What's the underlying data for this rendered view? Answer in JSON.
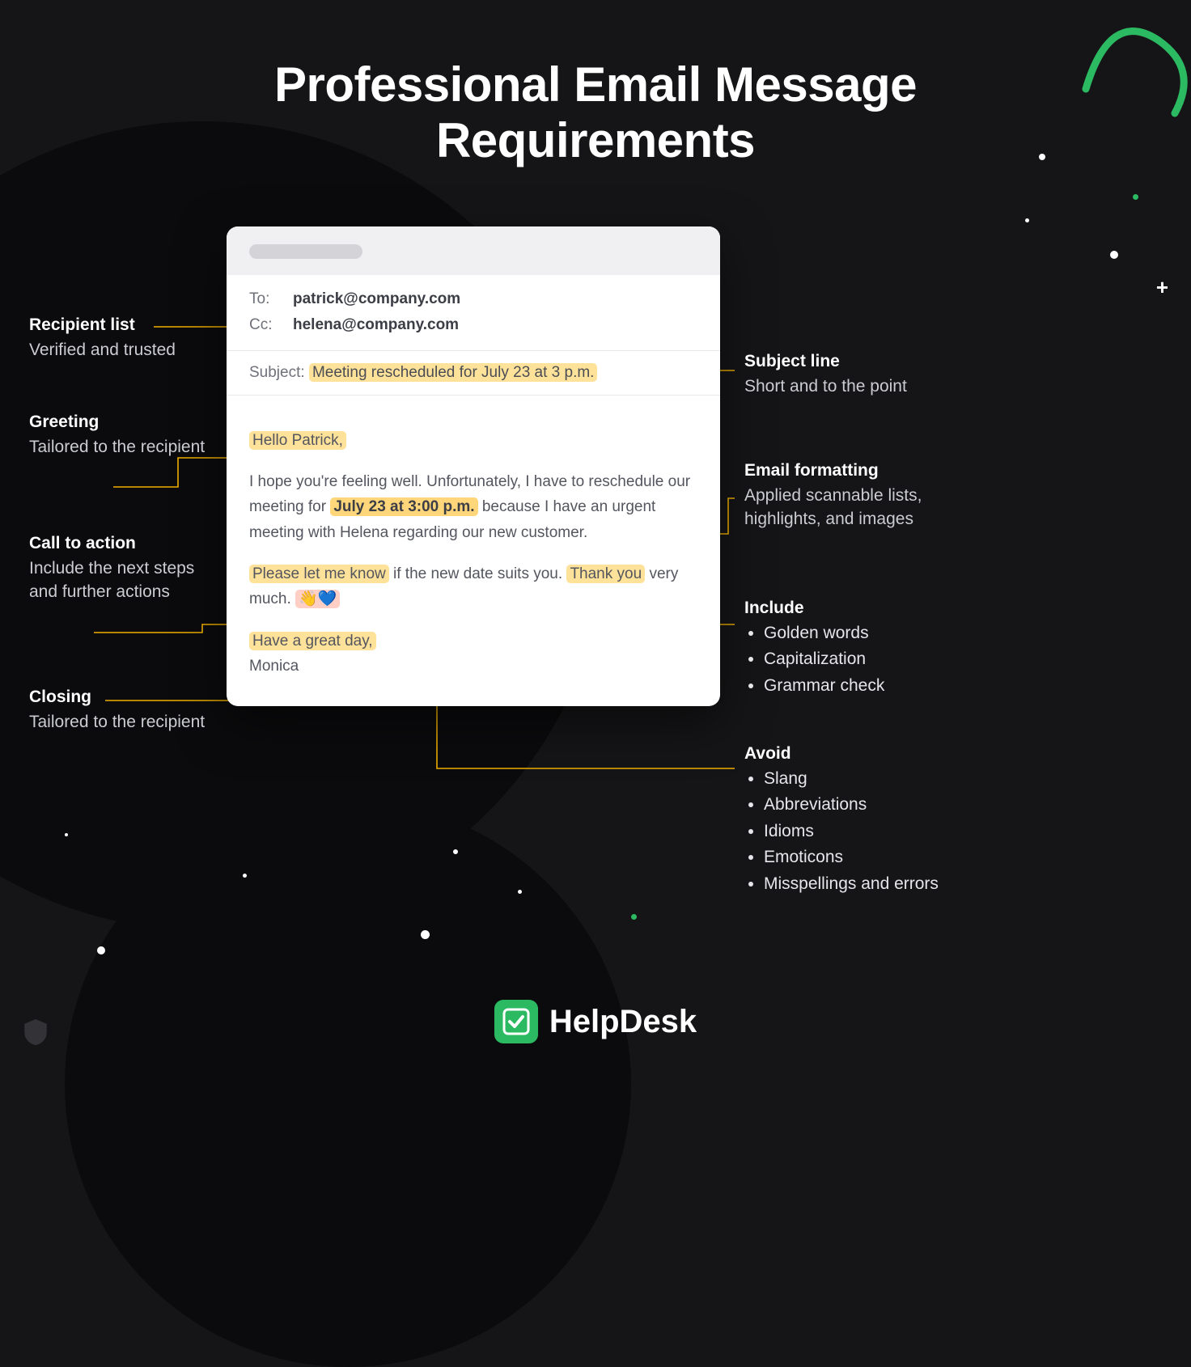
{
  "title": "Professional Email Message\nRequirements",
  "email": {
    "to_label": "To:",
    "to_value": "patrick@company.com",
    "cc_label": "Cc:",
    "cc_value": "helena@company.com",
    "subject_label": "Subject:",
    "subject_value": "Meeting rescheduled for July 23 at 3 p.m.",
    "greeting": "Hello Patrick,",
    "body_pre": "I hope you're feeling well. Unfortunately, I have to reschedule our meeting for ",
    "body_highlight_date": "July 23 at 3:00 p.m.",
    "body_post": " because I have an urgent meeting with Helena regarding our new customer.",
    "cta_hl": "Please let me know",
    "cta_mid": " if the new date suits you. ",
    "cta_thanks": "Thank you",
    "cta_tail": " very much. ",
    "emoji": "👋💙",
    "closing_hl": "Have a great day,",
    "signature": "Monica"
  },
  "left": {
    "recipient": {
      "h": "Recipient list",
      "d": "Verified and trusted"
    },
    "greeting": {
      "h": "Greeting",
      "d": "Tailored to the recipient"
    },
    "cta": {
      "h": "Call to action",
      "d": "Include the next steps and further actions"
    },
    "closing": {
      "h": "Closing",
      "d": "Tailored to the recipient"
    }
  },
  "right": {
    "subject": {
      "h": "Subject line",
      "d": "Short and to the point"
    },
    "formatting": {
      "h": "Email formatting",
      "d": "Applied scannable lists, highlights, and images"
    },
    "include": {
      "h": "Include",
      "items": [
        "Golden words",
        "Capitalization",
        "Grammar check"
      ]
    },
    "avoid": {
      "h": "Avoid",
      "items": [
        "Slang",
        "Abbreviations",
        "Idioms",
        "Emoticons",
        "Misspellings and errors"
      ]
    }
  },
  "footer": {
    "brand": "HelpDesk"
  },
  "colors": {
    "highlight": "#ffe29a",
    "accent": "#f0b000",
    "brand": "#2bb962",
    "bg": "#151517"
  }
}
